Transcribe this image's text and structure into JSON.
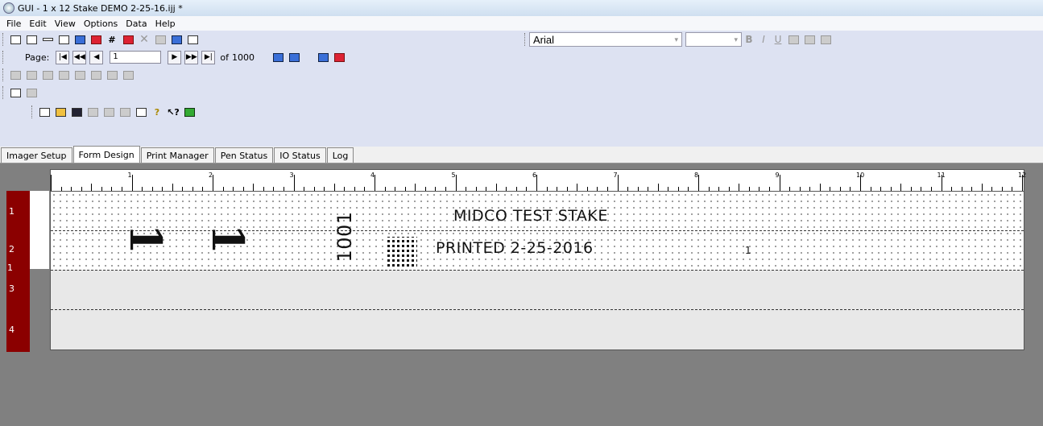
{
  "window": {
    "title": "GUI - 1 x 12 Stake DEMO 2-25-16.ijj *"
  },
  "menu": [
    "File",
    "Edit",
    "View",
    "Options",
    "Data",
    "Help"
  ],
  "pager": {
    "page_label": "Page:",
    "page_value": "1",
    "of_label": "of",
    "total": "1000"
  },
  "font": {
    "name": "Arial",
    "bold": "B",
    "italic": "I",
    "underline": "U"
  },
  "tabs": [
    "Imager Setup",
    "Form Design",
    "Print Manager",
    "Pen Status",
    "IO Status",
    "Log"
  ],
  "active_tab": "Form Design",
  "ruler_numbers": [
    "1",
    "2",
    "3",
    "4",
    "5",
    "6",
    "7",
    "8",
    "9",
    "10",
    "11",
    "12"
  ],
  "row_numbers": [
    "1",
    "2",
    "1",
    "3",
    "4"
  ],
  "design": {
    "number_1": "1",
    "number_2": "1",
    "vertical_text": "1001",
    "line1": "MIDCO TEST STAKE",
    "line2": "PRINTED 2-25-2016",
    "small_number": "1"
  },
  "colors": {
    "row_header": "#8b0000",
    "workspace": "#808080"
  }
}
